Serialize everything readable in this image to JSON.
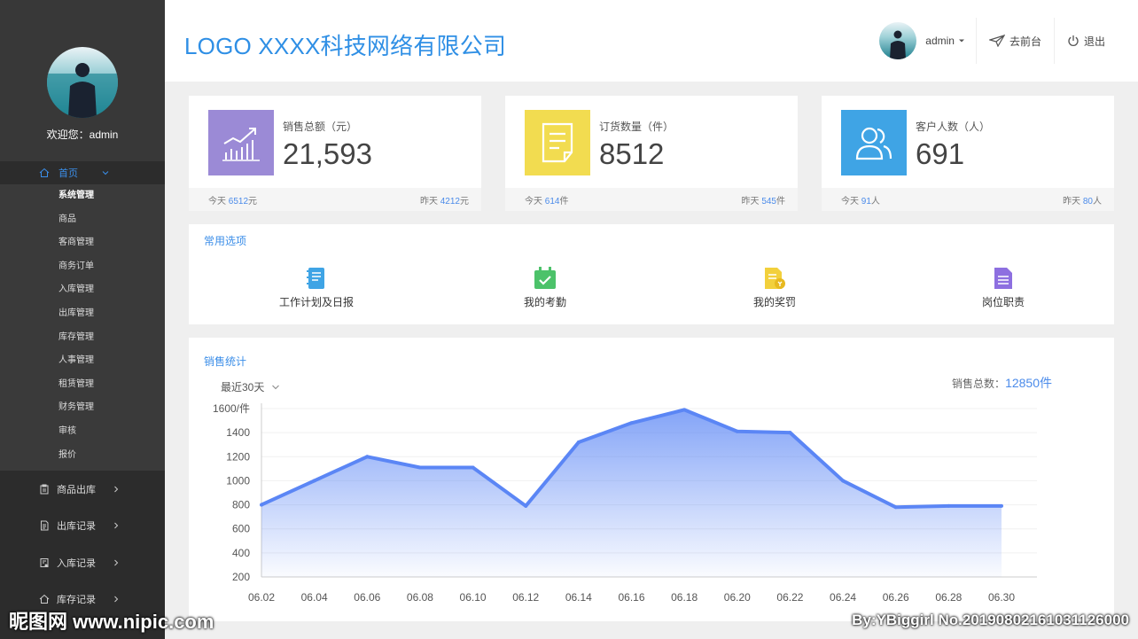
{
  "sidebar": {
    "welcome": "欢迎您：admin",
    "home_label": "首页",
    "sub_items": [
      "系统管理",
      "商品",
      "客商管理",
      "商务订单",
      "入库管理",
      "出库管理",
      "库存管理",
      "人事管理",
      "租赁管理",
      "财务管理",
      "审核",
      "报价"
    ],
    "groups": [
      {
        "label": "商品出库",
        "icon": "clipboard-icon"
      },
      {
        "label": "出库记录",
        "icon": "document-icon"
      },
      {
        "label": "入库记录",
        "icon": "receipt-icon"
      },
      {
        "label": "库存记录",
        "icon": "home-icon"
      }
    ]
  },
  "header": {
    "logo": "LOGO XXXX科技网络有限公司",
    "user": "admin",
    "front_label": "去前台",
    "logout_label": "退出"
  },
  "stats": [
    {
      "label": "销售总额（元）",
      "value": "21,593",
      "today_prefix": "今天",
      "today": "6512",
      "today_unit": "元",
      "yesterday_prefix": "昨天",
      "yesterday": "4212",
      "yesterday_unit": "元",
      "color": "#9b8ad6"
    },
    {
      "label": "订货数量（件）",
      "value": "8512",
      "today_prefix": "今天",
      "today": "614",
      "today_unit": "件",
      "yesterday_prefix": "昨天",
      "yesterday": "545",
      "yesterday_unit": "件",
      "color": "#f2dc50"
    },
    {
      "label": "客户人数（人）",
      "value": "691",
      "today_prefix": "今天",
      "today": "91",
      "today_unit": "人",
      "yesterday_prefix": "昨天",
      "yesterday": "80",
      "yesterday_unit": "人",
      "color": "#3fa4e5"
    }
  ],
  "options": {
    "title": "常用选项",
    "items": [
      {
        "label": "工作计划及日报",
        "icon": "notebook-icon",
        "color": "#3fa4e5"
      },
      {
        "label": "我的考勤",
        "icon": "calendar-check-icon",
        "color": "#4cc26a"
      },
      {
        "label": "我的奖罚",
        "icon": "award-document-icon",
        "color": "#f2d03c"
      },
      {
        "label": "岗位职责",
        "icon": "job-document-icon",
        "color": "#8d6fe0"
      }
    ]
  },
  "sales": {
    "title": "销售统计",
    "range": "最近30天",
    "total_label": "销售总数：",
    "total_value": "12850件"
  },
  "chart_data": {
    "type": "area",
    "x": [
      "06.02",
      "06.04",
      "06.06",
      "06.08",
      "06.10",
      "06.12",
      "06.14",
      "06.16",
      "06.18",
      "06.20",
      "06.22",
      "06.24",
      "06.26",
      "06.28",
      "06.30"
    ],
    "y": [
      800,
      1000,
      1200,
      1110,
      1110,
      790,
      1320,
      1480,
      1590,
      1410,
      1400,
      1000,
      780,
      790,
      790
    ],
    "yticks": [
      "200",
      "400",
      "600",
      "800",
      "1000",
      "1200",
      "1400",
      "1600/件"
    ],
    "ylim": [
      200,
      1600
    ],
    "line_color": "#5b86f5",
    "grid": true
  },
  "watermark": {
    "left": "昵图网 www.nipic.com",
    "right": "By:YBiggirl No.20190802161031126000"
  }
}
